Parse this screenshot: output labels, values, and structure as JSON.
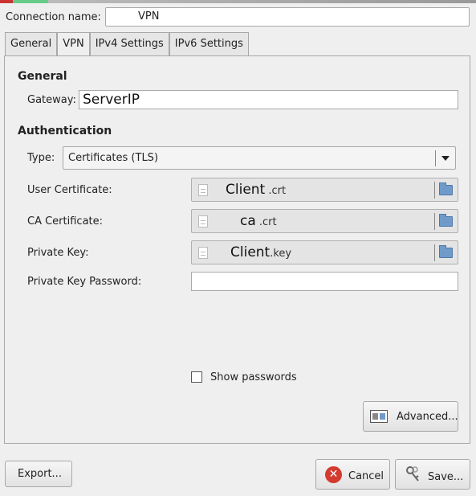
{
  "connection": {
    "label": "Connection name:",
    "value_suffix": "VPN"
  },
  "tabs": [
    {
      "label": "General"
    },
    {
      "label": "VPN"
    },
    {
      "label": "IPv4 Settings"
    },
    {
      "label": "IPv6 Settings"
    }
  ],
  "general": {
    "title": "General",
    "gateway_label": "Gateway:",
    "gateway_value": "ServerIP"
  },
  "authentication": {
    "title": "Authentication",
    "type_label": "Type:",
    "type_value": "Certificates (TLS)",
    "user_cert_label": "User Certificate:",
    "user_cert_name": "Client",
    "user_cert_ext": ".crt",
    "ca_cert_label": "CA Certificate:",
    "ca_cert_name": "ca",
    "ca_cert_ext": ".crt",
    "private_key_label": "Private Key:",
    "private_key_name": "Client",
    "private_key_ext": ".key",
    "private_key_password_label": "Private Key Password:",
    "private_key_password_value": ""
  },
  "show_passwords": {
    "label": "Show passwords",
    "checked": false
  },
  "buttons": {
    "advanced": "Advanced...",
    "export": "Export...",
    "cancel": "Cancel",
    "save": "Save..."
  },
  "icons": {
    "file": "document-icon",
    "folder": "folder-icon",
    "advanced": "advanced-settings-icon",
    "cancel": "cancel-icon",
    "save": "keys-icon"
  }
}
